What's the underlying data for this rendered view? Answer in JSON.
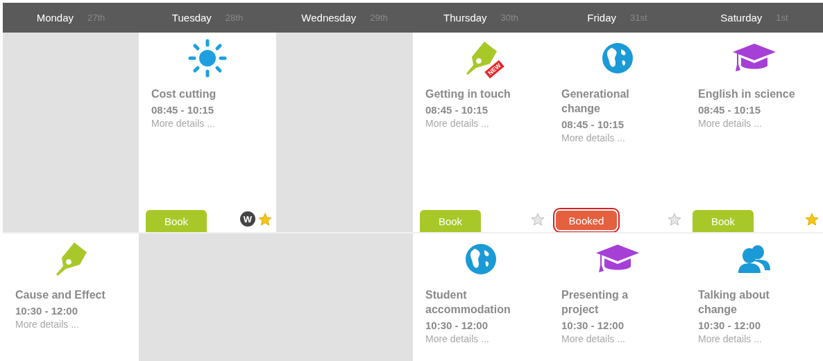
{
  "days": [
    {
      "name": "Monday",
      "date": "27th"
    },
    {
      "name": "Tuesday",
      "date": "28th"
    },
    {
      "name": "Wednesday",
      "date": "29th"
    },
    {
      "name": "Thursday",
      "date": "30th"
    },
    {
      "name": "Friday",
      "date": "31st"
    },
    {
      "name": "Saturday",
      "date": "1st"
    }
  ],
  "rows": [
    {
      "cells": [
        {
          "kind": "empty"
        },
        {
          "kind": "sun",
          "title": "Cost cutting",
          "time": "08:45 - 10:15",
          "details": "More details ...",
          "booking": {
            "label": "Book",
            "booked": false
          },
          "badge": "W",
          "favourite": true
        },
        {
          "kind": "empty"
        },
        {
          "kind": "pen",
          "ribbon": "NEW",
          "title": "Getting in touch",
          "time": "08:45 - 10:15",
          "details": "More details ...",
          "booking": {
            "label": "Book",
            "booked": false
          },
          "favourite": false
        },
        {
          "kind": "globe",
          "title": "Generational change",
          "time": "08:45 - 10:15",
          "details": "More details ...",
          "booking": {
            "label": "Booked",
            "booked": true
          },
          "favourite": false
        },
        {
          "kind": "cap",
          "title": "English in science",
          "time": "08:45 - 10:15",
          "details": "More details ...",
          "booking": {
            "label": "Book",
            "booked": false
          },
          "favourite": true
        }
      ]
    },
    {
      "cells": [
        {
          "kind": "pen",
          "title": "Cause and Effect",
          "time": "10:30 - 12:00",
          "details": "More details ..."
        },
        {
          "kind": "empty"
        },
        {
          "kind": "empty"
        },
        {
          "kind": "globe",
          "title": "Student accommodation",
          "time": "10:30 - 12:00",
          "details": "More details ..."
        },
        {
          "kind": "cap",
          "title": "Presenting a project",
          "time": "10:30 - 12:00",
          "details": "More details ..."
        },
        {
          "kind": "people",
          "title": "Talking about change",
          "time": "10:30 - 12:00",
          "details": "More details ..."
        }
      ]
    }
  ]
}
